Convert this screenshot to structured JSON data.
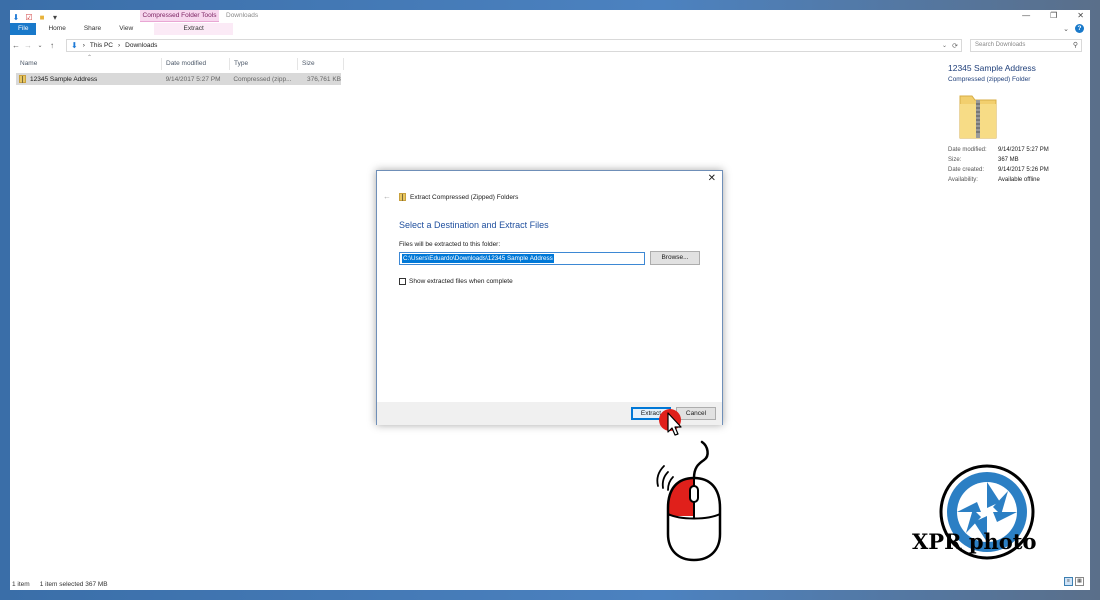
{
  "qat": {
    "items": [
      "down-arrow-icon",
      "properties-icon",
      "new-folder-icon",
      "customize-icon"
    ]
  },
  "ribbon": {
    "contextual_group": "Compressed Folder Tools",
    "window_title": "Downloads",
    "tabs": [
      "File",
      "Home",
      "Share",
      "View"
    ],
    "contextual_tab": "Extract",
    "win_controls": [
      "—",
      "❐",
      "✕"
    ],
    "help": "?"
  },
  "address": {
    "crumbs": [
      "This PC",
      "Downloads"
    ],
    "search_placeholder": "Search Downloads"
  },
  "file_list": {
    "columns": [
      "Name",
      "Date modified",
      "Type",
      "Size"
    ],
    "rows": [
      {
        "name": "12345 Sample Address",
        "date": "9/14/2017 5:27 PM",
        "type": "Compressed (zipp...",
        "size": "376,761 KB"
      }
    ]
  },
  "details": {
    "name": "12345 Sample Address",
    "kind": "Compressed (zipped) Folder",
    "props": [
      {
        "k": "Date modified:",
        "v": "9/14/2017 5:27 PM"
      },
      {
        "k": "Size:",
        "v": "367 MB"
      },
      {
        "k": "Date created:",
        "v": "9/14/2017 5:26 PM"
      },
      {
        "k": "Availability:",
        "v": "Available offline"
      }
    ]
  },
  "status": {
    "count": "1 item",
    "selected": "1 item selected  367 MB"
  },
  "dialog": {
    "header": "Extract Compressed (Zipped) Folders",
    "title": "Select a Destination and Extract Files",
    "label": "Files will be extracted to this folder:",
    "path": "C:\\Users\\Eduardo\\Downloads\\12345 Sample Address",
    "browse": "Browse...",
    "checkbox_label": "Show extracted files when complete",
    "checkbox_checked": false,
    "extract": "Extract",
    "cancel": "Cancel"
  },
  "watermark": {
    "text": "XPR photo"
  },
  "colors": {
    "accent": "#0078d7",
    "file_tab": "#1979ca",
    "contextual": "#f7d7ee",
    "click_red": "#e0201b"
  }
}
